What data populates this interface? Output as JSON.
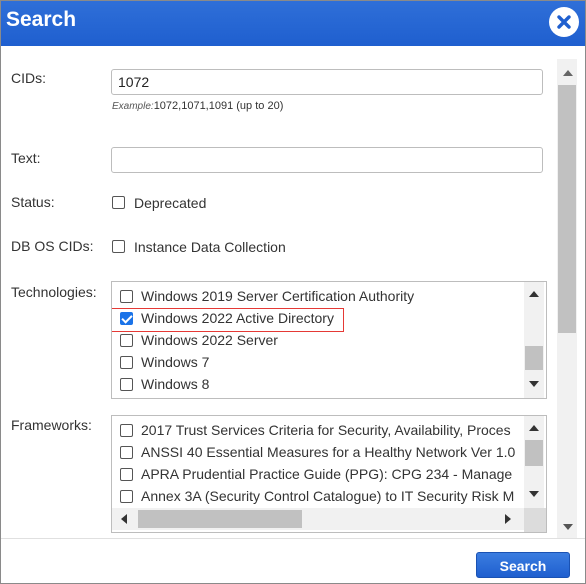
{
  "dialog": {
    "title": "Search",
    "close_icon": "close-icon",
    "accent_color": "#1f5fcf"
  },
  "fields": {
    "cids": {
      "label": "CIDs:",
      "value": "1072",
      "example_label": "Example:",
      "example_value": "1072,1071,1091 (up to 20)"
    },
    "text": {
      "label": "Text:",
      "value": ""
    },
    "status": {
      "label": "Status:",
      "option": "Deprecated",
      "checked": false
    },
    "db_os_cids": {
      "label": "DB OS CIDs:",
      "option": "Instance Data Collection",
      "checked": false
    },
    "technologies": {
      "label": "Technologies:",
      "items": [
        {
          "label": "Windows 2019 Server Certification Authority",
          "checked": false
        },
        {
          "label": "Windows 2022 Active Directory",
          "checked": true
        },
        {
          "label": "Windows 2022 Server",
          "checked": false
        },
        {
          "label": "Windows 7",
          "checked": false
        },
        {
          "label": "Windows 8",
          "checked": false
        }
      ]
    },
    "frameworks": {
      "label": "Frameworks:",
      "items": [
        {
          "label": "2017 Trust Services Criteria for Security, Availability, Proces",
          "checked": false
        },
        {
          "label": "ANSSI 40 Essential Measures for a Healthy Network Ver 1.0",
          "checked": false
        },
        {
          "label": "APRA Prudential Practice Guide (PPG): CPG 234 - Manage",
          "checked": false
        },
        {
          "label": "Annex 3A (Security Control Catalogue) to IT Security Risk M",
          "checked": false
        }
      ]
    }
  },
  "footer": {
    "search_label": "Search"
  }
}
